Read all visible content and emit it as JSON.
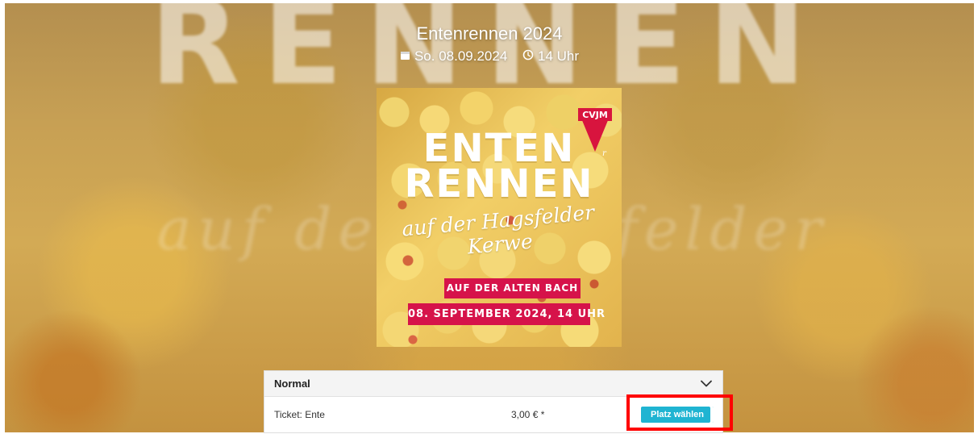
{
  "event": {
    "title": "Entenrennen 2024",
    "date": "So. 08.09.2024",
    "time": "14 Uhr"
  },
  "background": {
    "large_word": "RENNEN"
  },
  "poster": {
    "logo_text": "CVJM",
    "line1": "ENTEN",
    "line2": "RENNEN",
    "script": "auf der Hagsfelder Kerwe",
    "band1": "AUF DER ALTEN BACH",
    "band2": "08. SEPTEMBER 2024, 14 UHR"
  },
  "ticket_panel": {
    "header": "Normal",
    "ticket_name": "Ticket: Ente",
    "price": "3,00 € *",
    "button_label": "Platz wählen"
  },
  "colors": {
    "button": "#1fb4d2",
    "highlight": "#ff0000",
    "poster_band": "#d6134a"
  },
  "icons": {
    "date": "calendar-icon",
    "time": "clock-icon",
    "expand": "chevron-down-icon"
  }
}
